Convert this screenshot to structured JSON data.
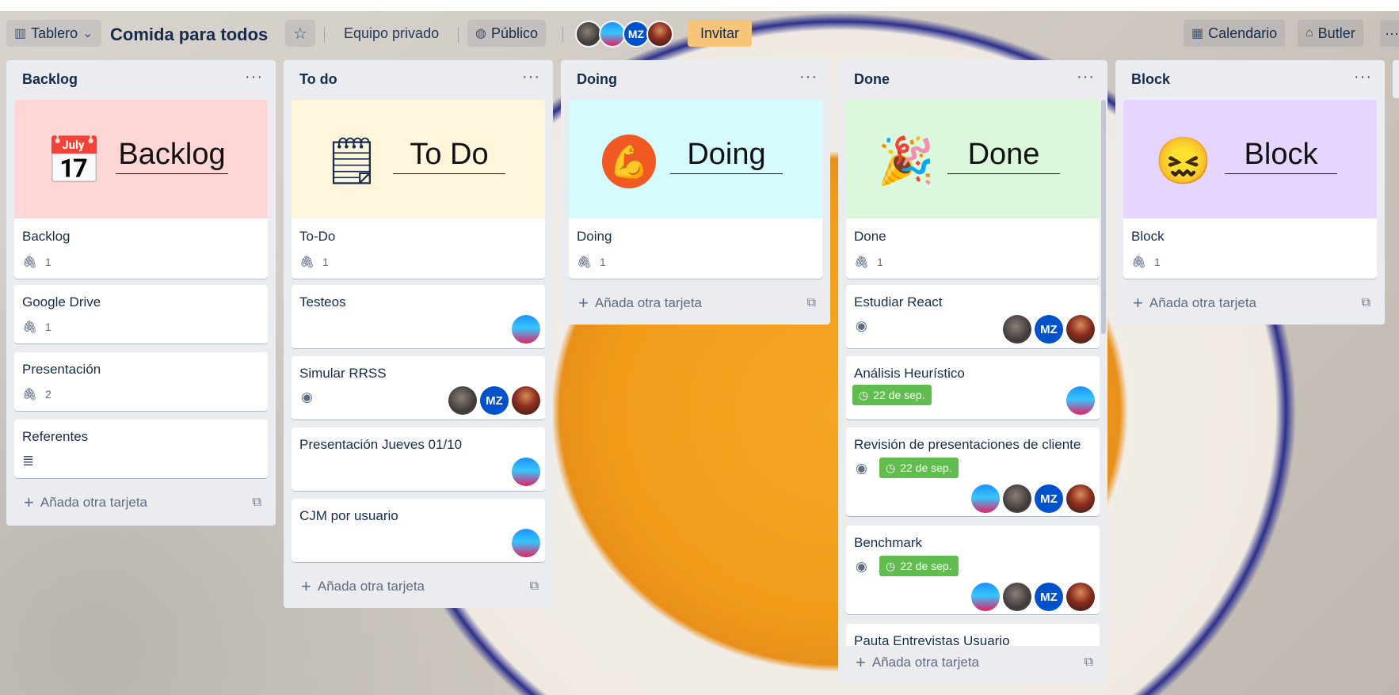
{
  "header": {
    "view_label": "Tablero",
    "board_title": "Comida para todos",
    "team_label": "Equipo privado",
    "visibility_label": "Público",
    "invite_label": "Invitar",
    "calendar_label": "Calendario",
    "butler_label": "Butler",
    "members": [
      {
        "type": "photo"
      },
      {
        "type": "photo"
      },
      {
        "initials": "MZ"
      },
      {
        "type": "photo"
      }
    ]
  },
  "lists": [
    {
      "title": "Backlog",
      "cover_word": "Backlog",
      "cards": [
        {
          "title": "Backlog",
          "attachments": "1"
        },
        {
          "title": "Google Drive",
          "attachments": "1"
        },
        {
          "title": "Presentación",
          "attachments": "2"
        },
        {
          "title": "Referentes"
        }
      ],
      "add_label": "Añada otra tarjeta"
    },
    {
      "title": "To do",
      "cover_word": "To Do",
      "cards": [
        {
          "title": "To-Do",
          "attachments": "1"
        },
        {
          "title": "Testeos"
        },
        {
          "title": "Simular RRSS"
        },
        {
          "title": "Presentación Jueves 01/10"
        },
        {
          "title": "CJM por usuario"
        }
      ],
      "add_label": "Añada otra tarjeta"
    },
    {
      "title": "Doing",
      "cover_word": "Doing",
      "cards": [
        {
          "title": "Doing",
          "attachments": "1"
        }
      ],
      "add_label": "Añada otra tarjeta"
    },
    {
      "title": "Done",
      "cover_word": "Done",
      "cards": [
        {
          "title": "Done",
          "attachments": "1"
        },
        {
          "title": "Estudiar React"
        },
        {
          "title": "Análisis Heurístico",
          "due": "22 de sep."
        },
        {
          "title": "Revisión de presentaciones de cliente",
          "due": "22 de sep."
        },
        {
          "title": "Benchmark",
          "due": "22 de sep."
        },
        {
          "title": "Pauta Entrevistas Usuario"
        }
      ],
      "add_label": "Añada otra tarjeta"
    },
    {
      "title": "Block",
      "cover_word": "Block",
      "cards": [
        {
          "title": "Block",
          "attachments": "1"
        }
      ],
      "add_label": "Añada otra tarjeta"
    }
  ],
  "member_initials": "MZ",
  "colors": {
    "backlog_cover": "#ffd6d6",
    "todo_cover": "#fff6dc",
    "doing_cover": "#d6fbff",
    "done_cover": "#dcf8dc",
    "block_cover": "#e6d6ff",
    "due_green": "#61bd4f",
    "mz_blue": "#0052cc"
  }
}
